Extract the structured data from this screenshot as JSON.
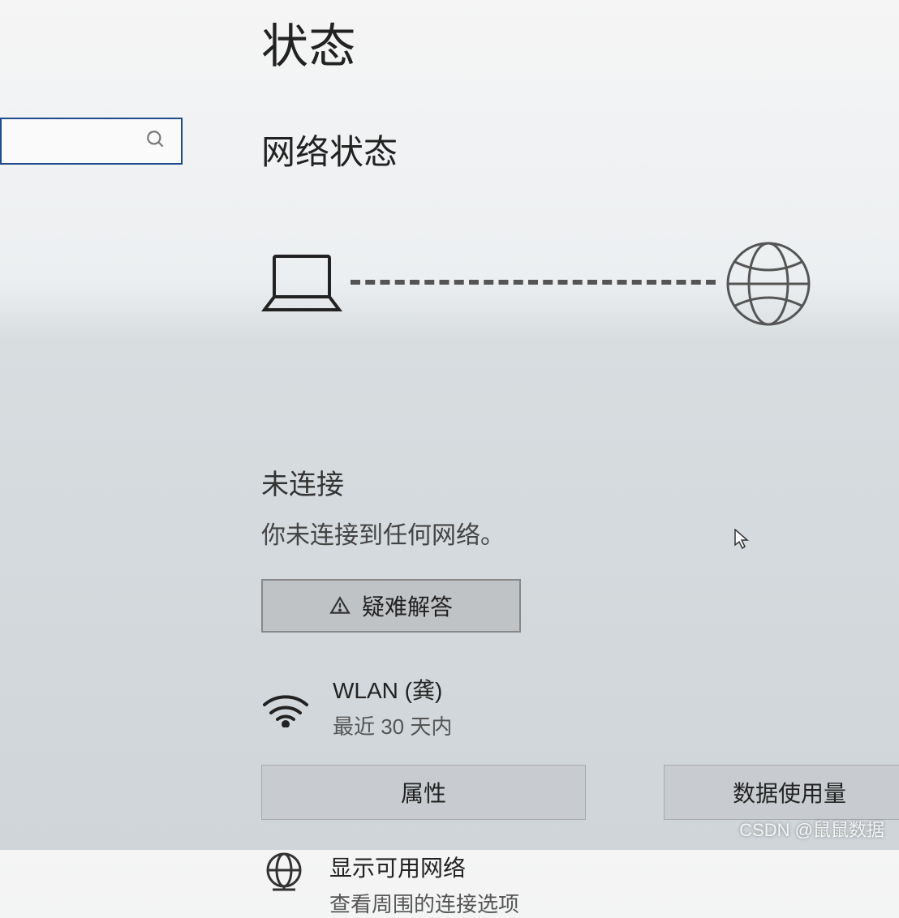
{
  "page": {
    "title": "状态",
    "section_title": "网络状态"
  },
  "search": {
    "placeholder": ""
  },
  "status": {
    "heading": "未连接",
    "description": "你未连接到任何网络。",
    "troubleshoot_label": "疑难解答"
  },
  "wlan": {
    "name": "WLAN (龚)",
    "subtitle": "最近 30 天内",
    "properties_label": "属性",
    "data_usage_label": "数据使用量"
  },
  "available": {
    "title": "显示可用网络",
    "subtitle": "查看周围的连接选项"
  },
  "watermark": "CSDN @鼠鼠数据"
}
